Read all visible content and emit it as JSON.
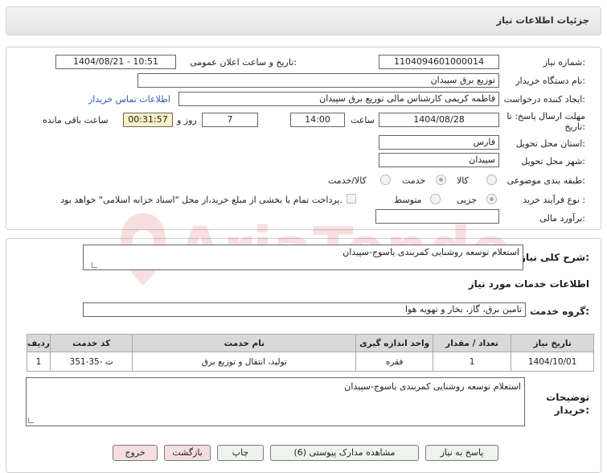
{
  "page": {
    "title": "جزئیات اطلاعات نیاز"
  },
  "form": {
    "need_number_label": "شماره نیاز:",
    "need_number": "1104094601000014",
    "announce_label": "تاریخ و ساعت اعلان عمومی:",
    "announce_value": "1404/08/21 - 10:51",
    "buyer_org_label": "نام دستگاه خریدار:",
    "buyer_org": "توزیع برق سپیدان",
    "creator_label": "ایجاد کننده درخواست:",
    "creator": "فاطمه کریمی کارشناس مالی توزیع برق سپیدان",
    "contact_link": "اطلاعات تماس خریدار",
    "deadline_label_1": "مهلت ارسال پاسخ: تا",
    "deadline_label_2": "تاریخ:",
    "deadline_date": "1404/08/28",
    "time_label": "ساعت",
    "deadline_time": "14:00",
    "days_value": "7",
    "days_label": "روز و",
    "remaining_time": "00:31:57",
    "remaining_label": "ساعت باقی مانده",
    "province_label": "استان محل تحویل:",
    "province": "فارس",
    "city_label": "شهر محل تحویل:",
    "city": "سپیدان",
    "category_label": "طبقه بندی موضوعی:",
    "category_options": [
      "کالا",
      "خدمت",
      "کالا/خدمت"
    ],
    "category_selected": "خدمت",
    "process_label": "نوع فرآیند خرید :",
    "process_options": [
      "جزیی",
      "متوسط"
    ],
    "process_selected": "جزیی",
    "payment_note": "پرداخت تمام یا بخشی از مبلغ خرید،از محل \"اسناد خزانه اسلامی\" خواهد بود.",
    "estimate_label": "برآورد مالی:",
    "estimate_value": ""
  },
  "description": {
    "label": "شرح کلی نیاز:",
    "value": "استعلام توسعه روشنایی کمربندی یاسوج-سپیدان"
  },
  "services": {
    "section_title": "اطلاعات خدمات مورد نیاز",
    "group_label": "گروه خدمت:",
    "group_value": "تامین برق، گاز، بخار و تهویه هوا",
    "columns": [
      "ردیف",
      "کد خدمت",
      "نام خدمت",
      "واحد اندازه گیری",
      "تعداد / مقدار",
      "تاریخ نیاز"
    ],
    "rows": [
      [
        "1",
        "ت -35-351",
        "تولید، انتقال و توزیع برق",
        "فقره",
        "1",
        "1404/10/01"
      ]
    ]
  },
  "buyer_notes": {
    "label_1": "توضیحات",
    "label_2": "خریدار:",
    "value": "استعلام توسعه روشنایی کمربندی یاسوج-سپیدان"
  },
  "buttons": {
    "reply": "پاسخ به نیاز",
    "view_docs": "مشاهده مدارک پیوستی (6)",
    "print": "چاپ",
    "back": "بازگشت",
    "exit": "خروج"
  },
  "watermark": {
    "text": "AriaTender.neT"
  }
}
